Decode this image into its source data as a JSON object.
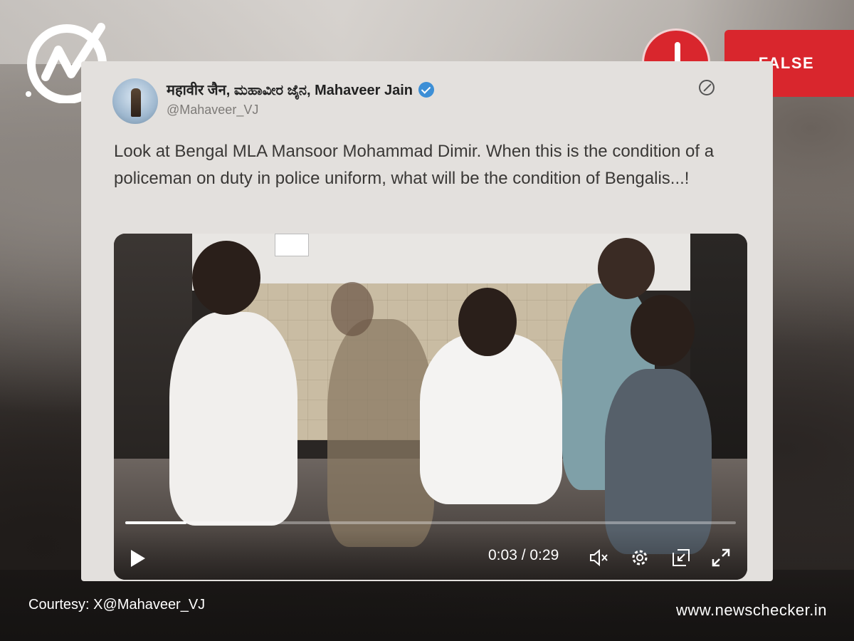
{
  "badge": {
    "label": "FALSE",
    "color": "#d9262d"
  },
  "tweet": {
    "author_name": "महावीर जैन, ಮಹಾವೀರ ಜೈನ, Mahaveer Jain",
    "handle": "@Mahaveer_VJ",
    "verified": true,
    "text": "Look at Bengal MLA Mansoor Mohammad Dimir. When this is the condition of a policeman on duty in police uniform, what will be the condition of Bengalis...!"
  },
  "video": {
    "time": "0:03 / 0:29",
    "progress_fraction": 0.1,
    "controls": [
      "play-icon",
      "mute-icon",
      "gear-icon",
      "pip-icon",
      "expand-icon"
    ]
  },
  "footer": {
    "courtesy": "Courtesy: X@Mahaveer_VJ",
    "site": "www.newschecker.in"
  }
}
